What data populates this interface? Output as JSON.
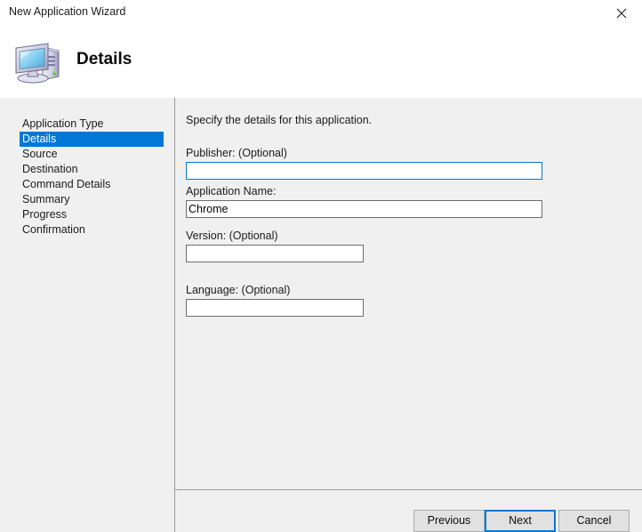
{
  "window": {
    "title": "New Application Wizard",
    "close_icon": "close-icon"
  },
  "header": {
    "icon": "computer-icon",
    "title": "Details"
  },
  "sidebar": {
    "items": [
      {
        "label": "Application Type",
        "selected": false
      },
      {
        "label": "Details",
        "selected": true
      },
      {
        "label": "Source",
        "selected": false
      },
      {
        "label": "Destination",
        "selected": false
      },
      {
        "label": "Command Details",
        "selected": false
      },
      {
        "label": "Summary",
        "selected": false
      },
      {
        "label": "Progress",
        "selected": false
      },
      {
        "label": "Confirmation",
        "selected": false
      }
    ]
  },
  "content": {
    "intro": "Specify the details for this application.",
    "fields": {
      "publisher": {
        "label": "Publisher: (Optional)",
        "value": "",
        "placeholder": "",
        "focused": true
      },
      "application_name": {
        "label": "Application Name:",
        "value": "Chrome",
        "placeholder": "",
        "focused": false
      },
      "version": {
        "label": "Version: (Optional)",
        "value": "",
        "placeholder": "",
        "focused": false
      },
      "language": {
        "label": "Language: (Optional)",
        "value": "",
        "placeholder": "",
        "focused": false
      }
    }
  },
  "footer": {
    "previous_label": "Previous",
    "next_label": "Next",
    "cancel_label": "Cancel"
  },
  "colors": {
    "accent": "#0078d7",
    "panel": "#f0f0f0",
    "button_face": "#e1e1e1",
    "border": "#6d6d6d",
    "separator": "#9a9a9a"
  }
}
